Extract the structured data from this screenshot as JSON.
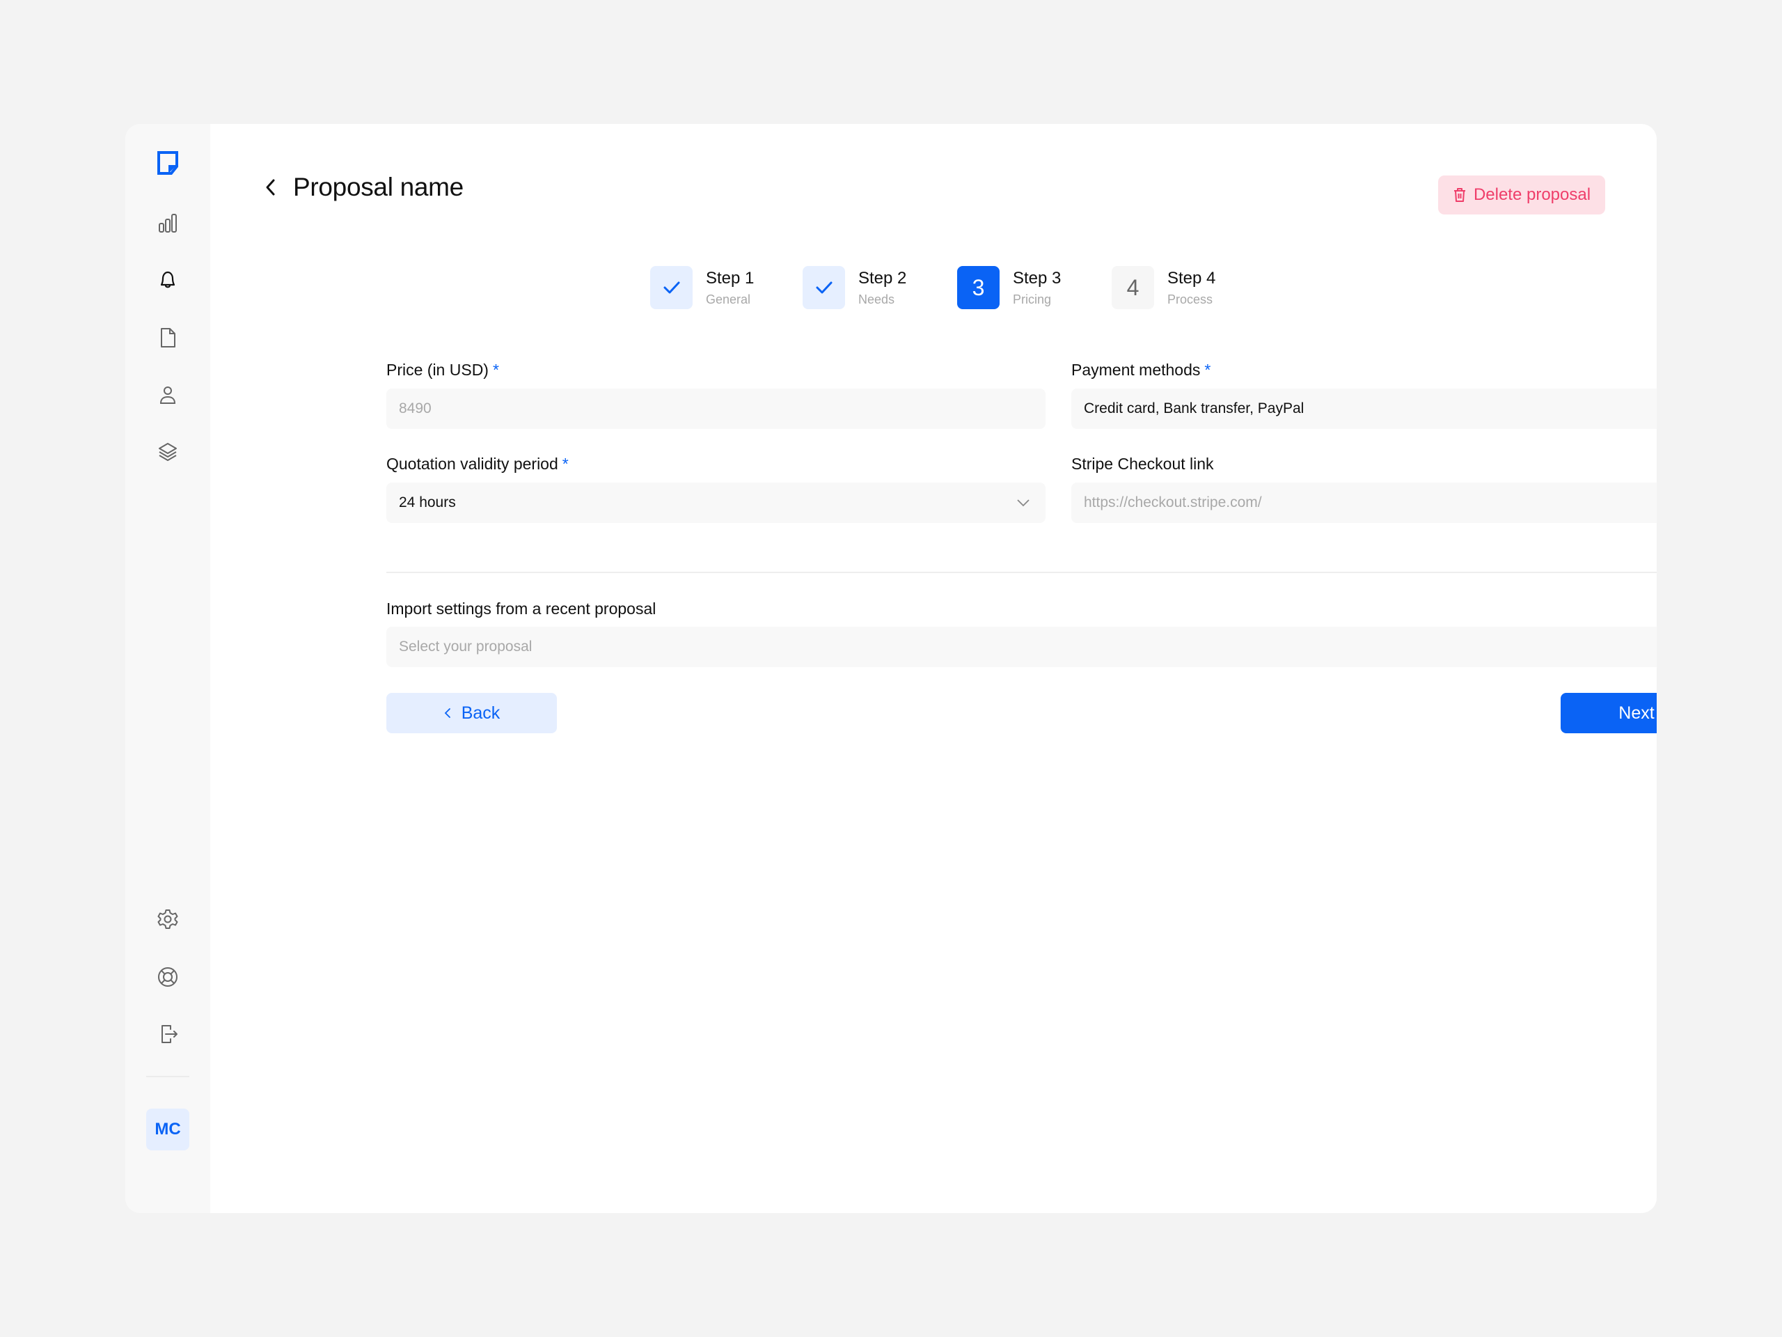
{
  "sidebar": {
    "logo": "document-logo-icon",
    "nav_items": [
      {
        "name": "analytics",
        "icon": "bar-chart-icon"
      },
      {
        "name": "notifications",
        "icon": "bell-icon",
        "active": true
      },
      {
        "name": "documents",
        "icon": "file-icon"
      },
      {
        "name": "contacts",
        "icon": "user-icon"
      },
      {
        "name": "layers",
        "icon": "layers-icon"
      }
    ],
    "bottom_items": [
      {
        "name": "settings",
        "icon": "gear-icon"
      },
      {
        "name": "help",
        "icon": "lifebuoy-icon"
      },
      {
        "name": "logout",
        "icon": "logout-icon"
      }
    ],
    "avatar_initials": "MC"
  },
  "header": {
    "title": "Proposal name",
    "delete_label": "Delete proposal"
  },
  "steps": [
    {
      "title": "Step 1",
      "subtitle": "General",
      "state": "done",
      "marker": "✓"
    },
    {
      "title": "Step 2",
      "subtitle": "Needs",
      "state": "done",
      "marker": "✓"
    },
    {
      "title": "Step 3",
      "subtitle": "Pricing",
      "state": "active",
      "marker": "3"
    },
    {
      "title": "Step 4",
      "subtitle": "Process",
      "state": "todo",
      "marker": "4"
    }
  ],
  "form": {
    "price": {
      "label": "Price (in USD)",
      "required": "*",
      "placeholder": "8490",
      "value": ""
    },
    "payment_methods": {
      "label": "Payment methods",
      "required": "*",
      "value": "Credit card, Bank transfer, PayPal"
    },
    "validity": {
      "label": "Quotation validity period",
      "required": "*",
      "value": "24 hours"
    },
    "stripe_link": {
      "label": "Stripe Checkout link",
      "placeholder": "https://checkout.stripe.com/",
      "value": ""
    },
    "import": {
      "label": "Import settings from a recent proposal",
      "placeholder": "Select your proposal"
    }
  },
  "actions": {
    "back_label": "Back",
    "next_label": "Next"
  },
  "colors": {
    "accent": "#0a63f5",
    "danger": "#ef3e6a",
    "danger_bg": "#fde0e6",
    "accent_light": "#e5eeff"
  }
}
